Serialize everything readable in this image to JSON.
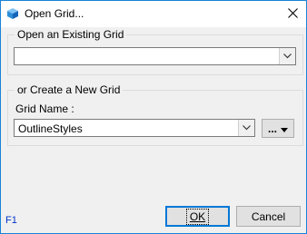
{
  "window": {
    "title": "Open Grid..."
  },
  "existing_group": {
    "legend": "Open an Existing Grid",
    "selected_value": ""
  },
  "new_group": {
    "legend": "or Create a New Grid",
    "grid_name_label": "Grid Name :",
    "grid_name_value": "OutlineStyles",
    "browse_label": "..."
  },
  "help_hint": "F1",
  "buttons": {
    "ok_label": "OK",
    "cancel_label": "Cancel"
  },
  "colors": {
    "accent": "#0078d7",
    "window_border": "#1883d7",
    "help_text": "#0033cc"
  }
}
